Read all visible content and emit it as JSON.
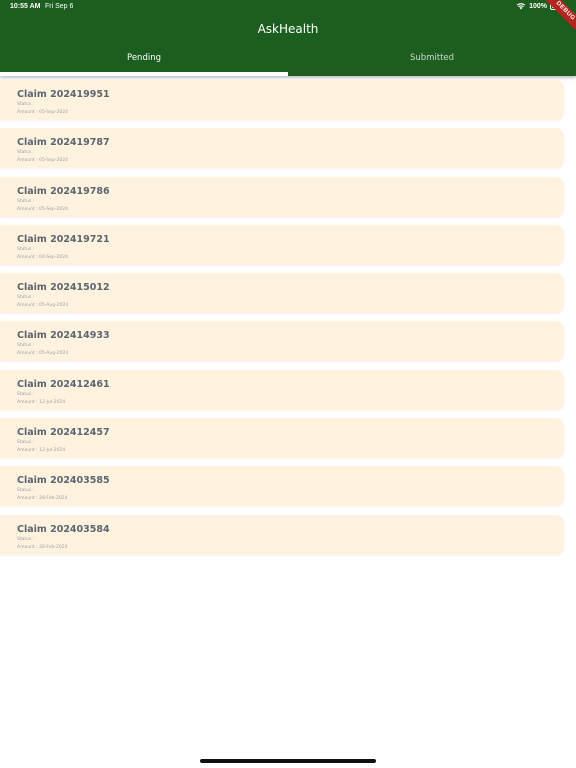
{
  "status_bar": {
    "time": "10:55 AM",
    "date": "Fri Sep 6",
    "battery": "100%"
  },
  "debug_ribbon": "DEBUG",
  "app": {
    "title": "AskHealth"
  },
  "tabs": [
    {
      "label": "Pending",
      "active": true
    },
    {
      "label": "Submitted",
      "active": false
    }
  ],
  "claims": [
    {
      "title": "Claim 202419951",
      "status_label": "Status :",
      "amount_label": "Amount :",
      "date": "05-Sep-2024"
    },
    {
      "title": "Claim 202419787",
      "status_label": "Status :",
      "amount_label": "Amount :",
      "date": "05-Sep-2024"
    },
    {
      "title": "Claim 202419786",
      "status_label": "Status :",
      "amount_label": "Amount :",
      "date": "05-Sep-2024"
    },
    {
      "title": "Claim 202419721",
      "status_label": "Status :",
      "amount_label": "Amount :",
      "date": "04-Sep-2024"
    },
    {
      "title": "Claim 202415012",
      "status_label": "Status :",
      "amount_label": "Amount :",
      "date": "05-Aug-2024"
    },
    {
      "title": "Claim 202414933",
      "status_label": "Status :",
      "amount_label": "Amount :",
      "date": "05-Aug-2024"
    },
    {
      "title": "Claim 202412461",
      "status_label": "Status :",
      "amount_label": "Amount :",
      "date": "12-Jul-2024"
    },
    {
      "title": "Claim 202412457",
      "status_label": "Status :",
      "amount_label": "Amount :",
      "date": "12-Jul-2024"
    },
    {
      "title": "Claim 202403585",
      "status_label": "Status :",
      "amount_label": "Amount :",
      "date": "28-Feb-2024"
    },
    {
      "title": "Claim 202403584",
      "status_label": "Status :",
      "amount_label": "Amount :",
      "date": "28-Feb-2024"
    }
  ],
  "colors": {
    "appbar": "#1c5e20",
    "card_background": "#fff2df",
    "claim_title": "#5a6570",
    "debug_ribbon": "#b3261e"
  },
  "icons": {
    "wifi": "wifi-icon",
    "battery": "battery-icon"
  }
}
